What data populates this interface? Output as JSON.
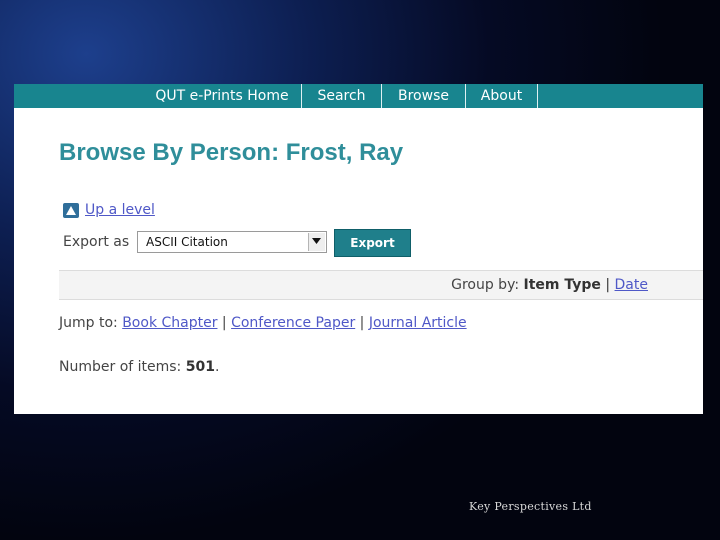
{
  "nav": {
    "items": [
      {
        "label": "QUT e-Prints Home"
      },
      {
        "label": "Search"
      },
      {
        "label": "Browse"
      },
      {
        "label": "About"
      }
    ],
    "bar_color": "#18858f"
  },
  "page": {
    "title": "Browse By Person: Frost, Ray",
    "up_level": "Up a level",
    "up_icon": "up-arrow-icon",
    "export_label": "Export as",
    "export_format": "ASCII Citation",
    "export_button": "Export",
    "group_by_label": "Group by:",
    "group_by_options": [
      "Item Type",
      "Date"
    ],
    "group_by_separator": "|",
    "jump_to_label": "Jump to:",
    "jump_links": [
      "Book Chapter",
      "Conference Paper",
      "Journal Article"
    ],
    "jump_separator": "|",
    "count_label": "Number of items:",
    "count_value": "501",
    "count_suffix": "."
  },
  "slide": {
    "footer": "Key Perspectives Ltd"
  },
  "colors": {
    "title": "#2f8e9a",
    "link": "#4f58c7",
    "button": "#1f7f8b"
  }
}
